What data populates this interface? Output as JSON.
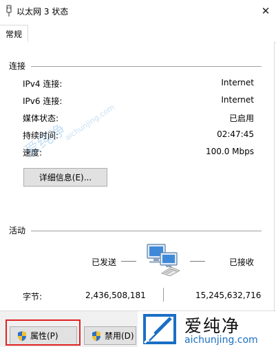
{
  "window": {
    "title": "以太网 3 状态",
    "close_glyph": "✕"
  },
  "tabs": [
    {
      "label": "常规"
    }
  ],
  "connection": {
    "group_label": "连接",
    "rows": [
      {
        "label": "IPv4 连接:",
        "value": "Internet"
      },
      {
        "label": "IPv6 连接:",
        "value": "Internet"
      },
      {
        "label": "媒体状态:",
        "value": "已启用"
      },
      {
        "label": "持续时间:",
        "value": "02:47:45"
      },
      {
        "label": "速度:",
        "value": "100.0 Mbps"
      }
    ],
    "details_button": "详细信息(E)..."
  },
  "activity": {
    "group_label": "活动",
    "sent_label": "已发送",
    "received_label": "已接收",
    "bytes_label": "字节:",
    "bytes_sent": "2,436,508,181",
    "bytes_received": "15,245,632,716"
  },
  "buttons": {
    "properties": "属性(P)",
    "disable": "禁用(D)"
  },
  "watermark": {
    "name": "爱纯净",
    "url": "aichunjing.com"
  },
  "colors": {
    "highlight": "#e02020",
    "brand_blue": "#1a6fc4",
    "shield_blue": "#2f6fc0",
    "shield_yellow": "#f2c230"
  }
}
